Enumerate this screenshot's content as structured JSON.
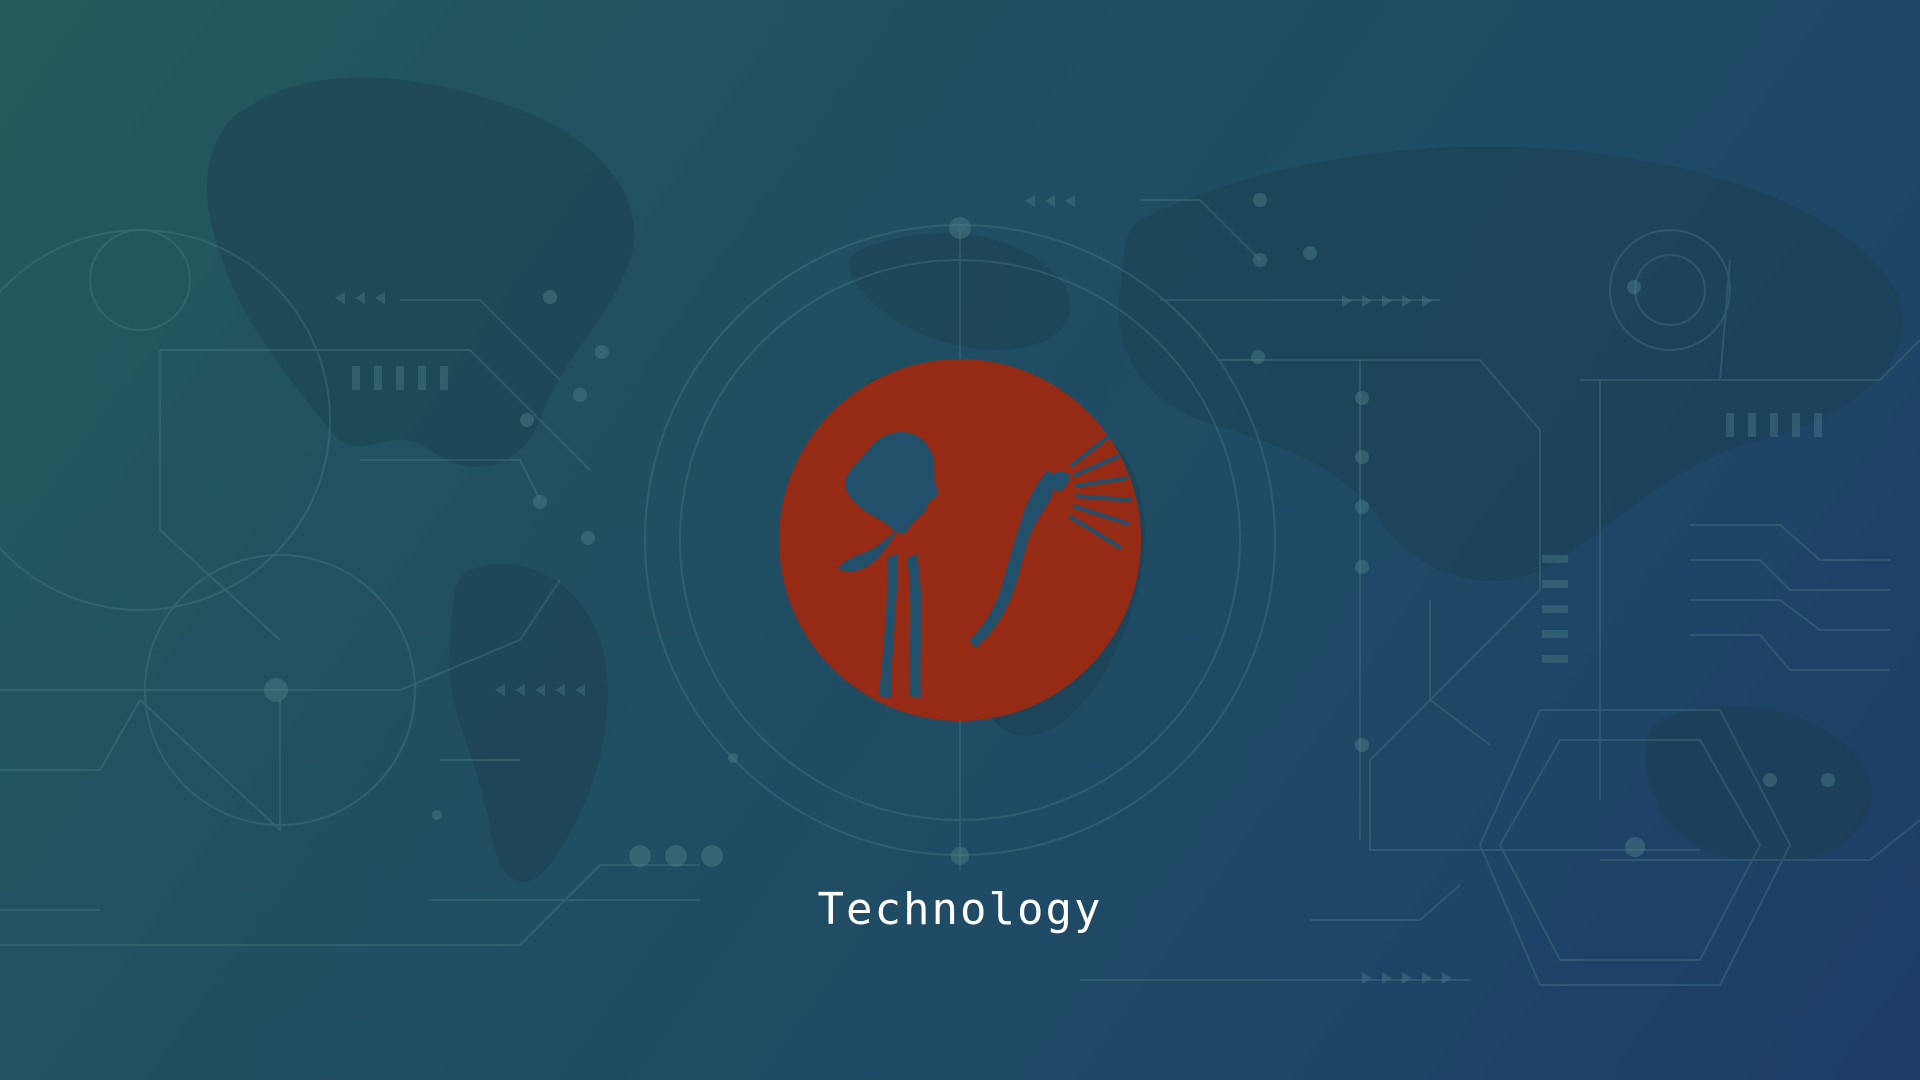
{
  "screen": {
    "caption": "Technology",
    "background_colors": [
      "#255a5c",
      "#214f60",
      "#1f4a66",
      "#1d3c66"
    ],
    "accent_color": "#952a15",
    "emblem_icon": "figure-holding-light-icon"
  }
}
